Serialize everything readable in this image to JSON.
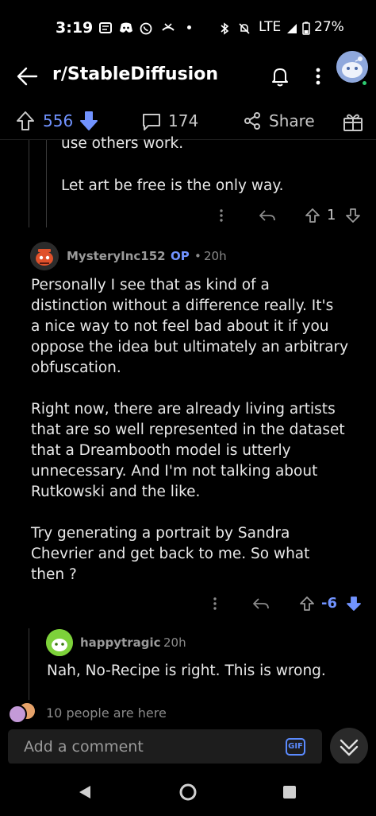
{
  "status_bar": {
    "time": "3:19",
    "network": "LTE",
    "battery": "27%"
  },
  "header": {
    "title": "r/StableDiffusion"
  },
  "votebar": {
    "score": "556",
    "comments": "174",
    "share_label": "Share"
  },
  "prev_comment": {
    "line1": "use others work.",
    "line2": "Let art be free is the only way.",
    "score": "1"
  },
  "comment": {
    "author": "MysteryInc152",
    "op_badge": "OP",
    "separator": "•",
    "age": "20h",
    "paragraphs": [
      [
        "Personally I see that as kind of a",
        "distinction without a difference really. It's",
        "a nice way to not feel bad about it if you",
        "oppose the idea but ultimately an arbitrary",
        "obfuscation."
      ],
      [
        "Right now, there are already living artists",
        "that are so well represented in the dataset",
        "that a Dreambooth model is utterly",
        "unnecessary. And I'm not talking about",
        "Rutkowski and the like."
      ],
      [
        "Try generating a portrait by Sandra",
        "Chevrier and get back to me. So what",
        "then ?"
      ]
    ],
    "score": "-6"
  },
  "reply": {
    "author": "happytragic",
    "age": "20h",
    "text": "Nah, No-Recipe is right. This is wrong."
  },
  "presence": {
    "text": "10 people are here"
  },
  "composer": {
    "placeholder": "Add a comment",
    "gif_label": "GIF"
  },
  "colors": {
    "accent": "#7193ff",
    "background": "#000000",
    "text": "#d7dadc",
    "muted": "#8a8a8a"
  }
}
